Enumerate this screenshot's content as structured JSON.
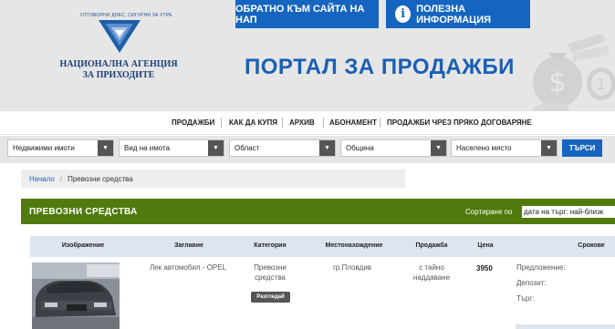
{
  "header": {
    "logo_tagline": "ОТГОВОРНИ ДНЕС. СИГУРНИ ЗА УТРЕ",
    "logo_name_line1": "НАЦИОНАЛНА АГЕНЦИЯ",
    "logo_name_line2": "ЗА ПРИХОДИТЕ",
    "back_button": "ОБРАТНО КЪМ САЙТА НА НАП",
    "info_button": "ПОЛЕЗНА ИНФОРМАЦИЯ",
    "portal_title": "ПОРТАЛ ЗА ПРОДАЖБИ",
    "accent_color": "#1565c0"
  },
  "nav": {
    "items": [
      "ПРОДАЖБИ",
      "КАК ДА КУПЯ",
      "АРХИВ",
      "АБОНАМЕНТ",
      "ПРОДАЖБИ ЧРЕЗ ПРЯКО ДОГОВАРЯНЕ"
    ]
  },
  "filters": {
    "selects": [
      "Недвижими имоти",
      "Вид на имота",
      "Област",
      "Община",
      "Населено място"
    ],
    "search_button": "ТЪРСИ"
  },
  "breadcrumb": {
    "home": "Начало",
    "separator": "/",
    "current": "Превозни средства"
  },
  "section": {
    "title": "ПРЕВОЗНИ СРЕДСТВА",
    "sort_label": "Сортиране по",
    "sort_value": "дата на търг: най-близк",
    "bar_color": "#507b0c"
  },
  "table": {
    "headers": [
      "Изображение",
      "Заглавие",
      "Категория",
      "Местонахождение",
      "Продажба",
      "Цена",
      "Срокове"
    ],
    "rows": [
      {
        "title": "Лек автомобил - OPEL",
        "category_line1": "Превозни",
        "category_line2": "средства",
        "category_badge": "Разгледай",
        "location": "гр.Пловдив",
        "sale_line1": "с тайно",
        "sale_line2": "наддаване",
        "price": "3950",
        "terms": [
          "Предложение:",
          "Депозит:",
          "Търг:"
        ]
      }
    ]
  }
}
